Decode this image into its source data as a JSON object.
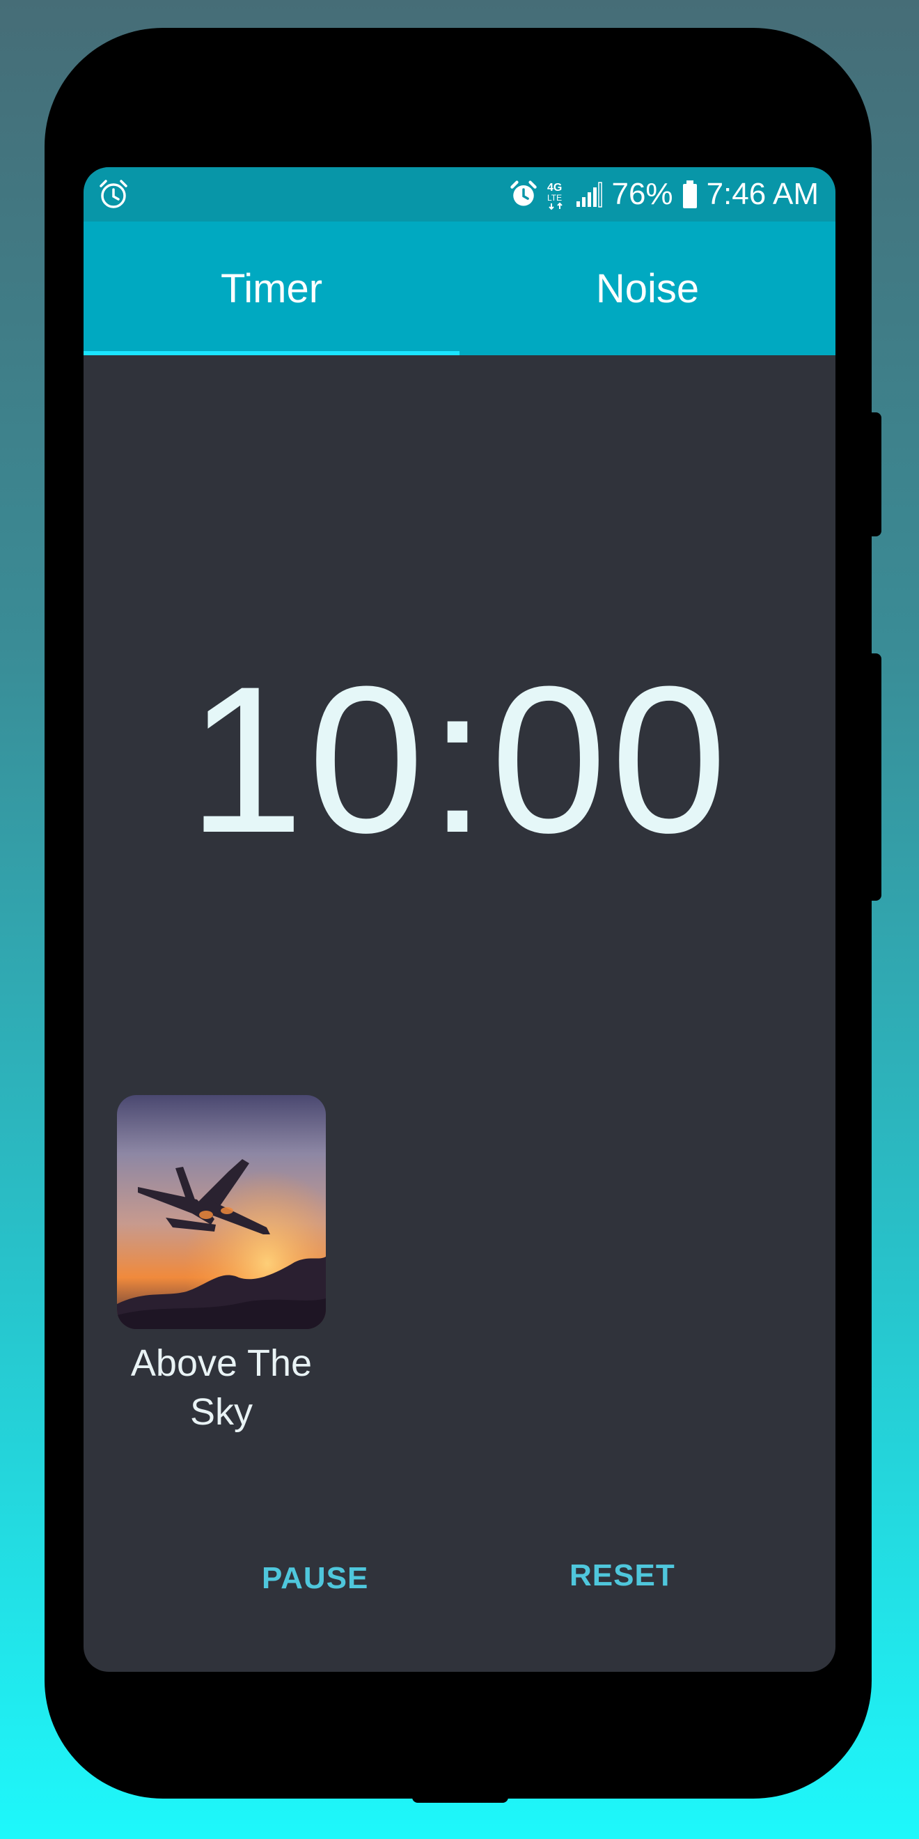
{
  "status_bar": {
    "battery": "76%",
    "time": "7:46 AM",
    "network": "4G LTE"
  },
  "tabs": [
    {
      "label": "Timer",
      "selected": true
    },
    {
      "label": "Noise",
      "selected": false
    }
  ],
  "timer": {
    "display": "10:00"
  },
  "sounds": [
    {
      "title": "Above The Sky",
      "image": "airplane-sunset"
    }
  ],
  "controls": {
    "pause_label": "PAUSE",
    "reset_label": "RESET"
  },
  "colors": {
    "status_bar": "#0896a8",
    "tab_bar": "#00a9c1",
    "tab_indicator": "#1be4ff",
    "screen_bg": "#30333b",
    "accent_text": "#4fc7dc"
  }
}
